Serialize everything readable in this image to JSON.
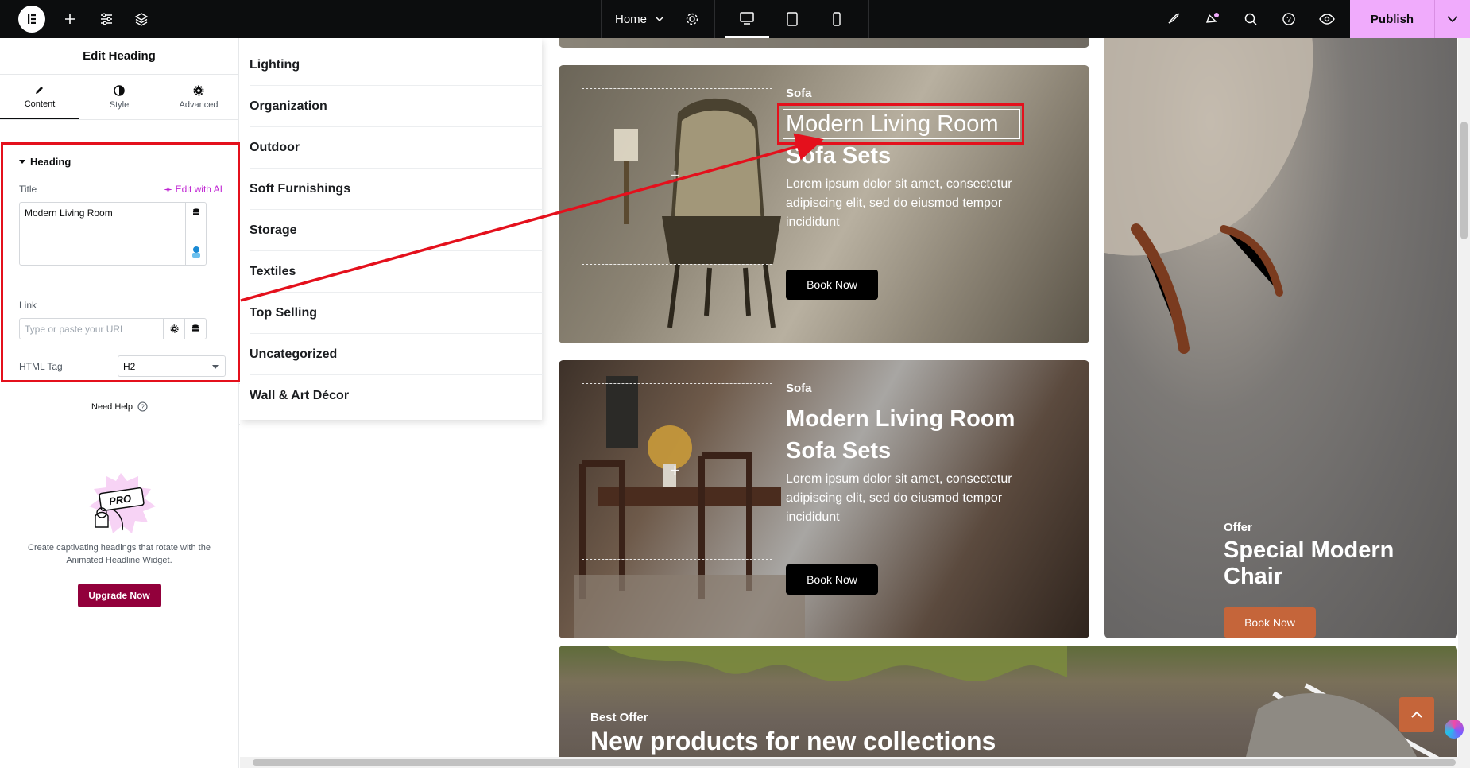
{
  "topbar": {
    "page_name": "Home",
    "publish_label": "Publish"
  },
  "panel": {
    "title": "Edit Heading",
    "tabs": [
      {
        "label": "Content",
        "icon": "pencil-icon"
      },
      {
        "label": "Style",
        "icon": "half-circle-icon"
      },
      {
        "label": "Advanced",
        "icon": "gear-icon"
      }
    ],
    "section_label": "Heading",
    "title_label": "Title",
    "edit_ai_label": "Edit with AI",
    "title_value": "Modern Living Room",
    "link_label": "Link",
    "link_placeholder": "Type or paste your URL",
    "html_tag_label": "HTML Tag",
    "html_tag_value": "H2",
    "need_help": "Need Help",
    "promo_text": "Create captivating headings that rotate with the Animated Headline Widget.",
    "promo_badge": "PRO",
    "upgrade_label": "Upgrade Now"
  },
  "categories": [
    "Lighting",
    "Organization",
    "Outdoor",
    "Soft Furnishings",
    "Storage",
    "Textiles",
    "Top Selling",
    "Uncategorized",
    "Wall & Art Décor"
  ],
  "cards": [
    {
      "kicker": "Sofa",
      "heading": "Modern Living Room",
      "subheading": "Sofa Sets",
      "text": "Lorem ipsum dolor sit amet, consectetur adipiscing elit, sed do eiusmod tempor incididunt",
      "button": "Book Now"
    },
    {
      "kicker": "Sofa",
      "heading": "Modern Living Room",
      "subheading": "Sofa Sets",
      "text": "Lorem ipsum dolor sit amet, consectetur adipiscing elit, sed do eiusmod tempor incididunt",
      "button": "Book Now"
    }
  ],
  "offer": {
    "kicker": "Offer",
    "heading": "Special Modern Chair",
    "button": "Book Now"
  },
  "best_offer": {
    "kicker": "Best Offer",
    "heading": "New products for new collections"
  },
  "colors": {
    "accent_pink": "#f0abfc",
    "upgrade": "#92003b",
    "highlight_red": "#e4101c",
    "offer_button": "#c5653a"
  }
}
